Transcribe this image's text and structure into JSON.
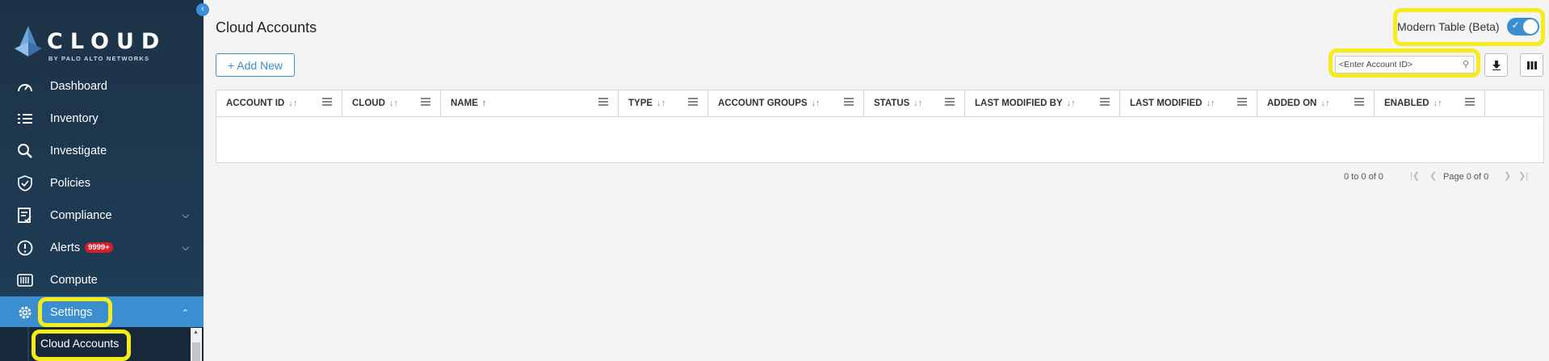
{
  "sidebar": {
    "logo_text": "CLOUD",
    "logo_sub": "BY PALO ALTO NETWORKS",
    "items": [
      {
        "label": "Dashboard"
      },
      {
        "label": "Inventory"
      },
      {
        "label": "Investigate"
      },
      {
        "label": "Policies"
      },
      {
        "label": "Compliance"
      },
      {
        "label": "Alerts",
        "badge": "9999+"
      },
      {
        "label": "Compute"
      },
      {
        "label": "Settings"
      }
    ],
    "sub_items": [
      {
        "label": "Cloud Accounts"
      }
    ]
  },
  "header": {
    "title": "Cloud Accounts",
    "toggle_label": "Modern Table (Beta)"
  },
  "toolbar": {
    "add_label": "+ Add New",
    "search_placeholder": "<Enter Account ID>"
  },
  "table": {
    "columns": [
      {
        "label": "ACCOUNT ID",
        "sort": "↓↑"
      },
      {
        "label": "CLOUD",
        "sort": "↓↑"
      },
      {
        "label": "NAME",
        "sort": "↑"
      },
      {
        "label": "TYPE",
        "sort": "↓↑"
      },
      {
        "label": "ACCOUNT GROUPS",
        "sort": "↓↑"
      },
      {
        "label": "STATUS",
        "sort": "↓↑"
      },
      {
        "label": "LAST MODIFIED BY",
        "sort": "↓↑"
      },
      {
        "label": "LAST MODIFIED",
        "sort": "↓↑"
      },
      {
        "label": "ADDED ON",
        "sort": "↓↑"
      },
      {
        "label": "ENABLED",
        "sort": "↓↑"
      }
    ],
    "rows": []
  },
  "pagination": {
    "range": "0 to 0 of 0",
    "page": "Page 0 of 0"
  },
  "colors": {
    "accent": "#3b8ed0",
    "sidebar_bg": "#1e3a52",
    "highlight": "#f5ec1a",
    "badge": "#d61f2b"
  }
}
